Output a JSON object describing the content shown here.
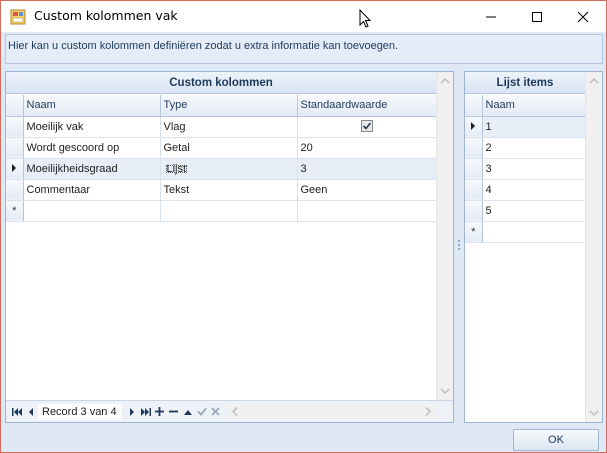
{
  "window": {
    "title": "Custom kolommen vak",
    "icon": "form-icon",
    "controls": [
      "minimize-icon",
      "maximize-icon",
      "close-icon"
    ]
  },
  "info": {
    "text": "Hier kan u custom kolommen definiëren zodat u extra informatie kan toevoegen."
  },
  "custom_columns": {
    "title": "Custom kolommen",
    "headers": [
      "Naam",
      "Type",
      "Standaardwaarde"
    ],
    "rows": [
      {
        "naam": "Moeilijk vak",
        "type": "Vlag",
        "standaard": "",
        "checked": true
      },
      {
        "naam": "Wordt gescoord op",
        "type": "Getal",
        "standaard": "20"
      },
      {
        "naam": "Moeilijkheidsgraad",
        "type": "Lijst",
        "standaard": "3"
      },
      {
        "naam": "Commentaar",
        "type": "Tekst",
        "standaard": "Geen"
      }
    ],
    "current_row_index": 2,
    "new_row_marker": "*",
    "navigator": {
      "record_text": "Record 3 van 4"
    }
  },
  "list_items": {
    "title": "Lijst items",
    "header": "Naam",
    "rows": [
      "1",
      "2",
      "3",
      "4",
      "5"
    ],
    "current_row_index": 0,
    "new_row_marker": "*"
  },
  "footer": {
    "ok_label": "OK"
  },
  "colors": {
    "window_border": "#d46b5a",
    "body_bg": "#dfe9f5",
    "header_text": "#1e395b"
  }
}
